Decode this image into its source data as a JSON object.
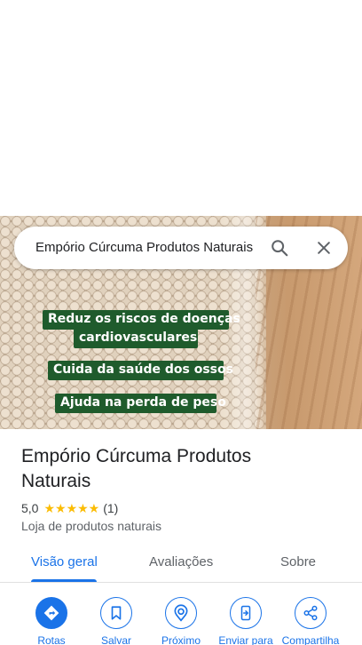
{
  "search": {
    "value": "Empório Cúrcuma Produtos Naturais",
    "search_icon": "search-icon",
    "close_icon": "close-icon"
  },
  "photo": {
    "captions": [
      "Reduz os riscos de doenças",
      "cardiovasculares",
      "Cuida da saúde dos ossos",
      "Ajuda na perda de peso"
    ]
  },
  "place": {
    "name": "Empório Cúrcuma Produtos Naturais",
    "rating": "5,0",
    "stars": "★★★★★",
    "review_count": "(1)",
    "category": "Loja de produtos naturais"
  },
  "tabs": [
    {
      "label": "Visão geral",
      "active": true
    },
    {
      "label": "Avaliações",
      "active": false
    },
    {
      "label": "Sobre",
      "active": false
    }
  ],
  "actions": [
    {
      "label": "Rotas",
      "icon": "directions-icon"
    },
    {
      "label": "Salvar",
      "icon": "bookmark-icon"
    },
    {
      "label": "Próximo",
      "icon": "nearby-icon"
    },
    {
      "label": "Enviar para",
      "icon": "send-to-phone-icon"
    },
    {
      "label": "Compartilha",
      "icon": "share-icon"
    }
  ],
  "colors": {
    "accent": "#1a73e8",
    "star": "#fbbc04",
    "caption_bg": "#1f5b2c"
  }
}
